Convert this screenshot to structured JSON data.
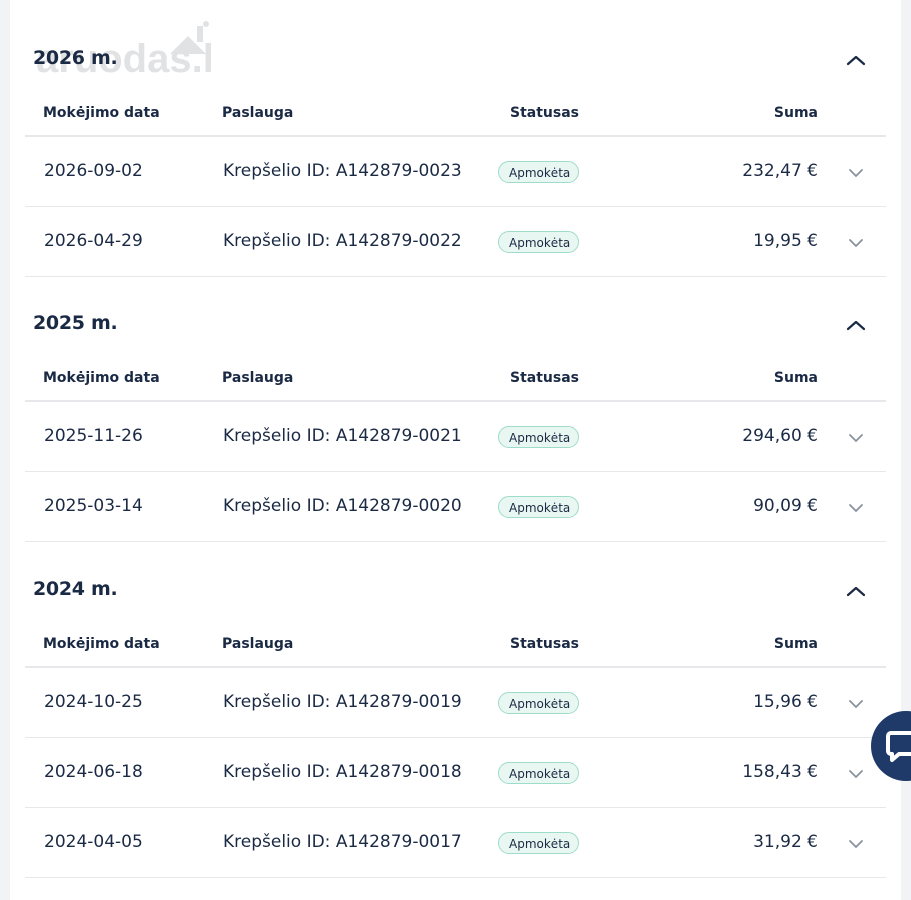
{
  "brand": {
    "logo_text": "aruodas.lt"
  },
  "colors": {
    "text": "#1b2a44",
    "badge_bg": "#e9f7f2",
    "badge_border": "#9edbc9",
    "chat_bg": "#1f3a68"
  },
  "columns": {
    "date": "Mokėjimo data",
    "service": "Paslauga",
    "status": "Statusas",
    "sum": "Suma"
  },
  "sections": [
    {
      "year": "2026 m.",
      "rows": [
        {
          "date": "2026-09-02",
          "service": "Krepšelio ID: A142879-0023",
          "status": "Apmokėta",
          "sum": "232,47 €"
        },
        {
          "date": "2026-04-29",
          "service": "Krepšelio ID: A142879-0022",
          "status": "Apmokėta",
          "sum": "19,95 €"
        }
      ]
    },
    {
      "year": "2025 m.",
      "rows": [
        {
          "date": "2025-11-26",
          "service": "Krepšelio ID: A142879-0021",
          "status": "Apmokėta",
          "sum": "294,60 €"
        },
        {
          "date": "2025-03-14",
          "service": "Krepšelio ID: A142879-0020",
          "status": "Apmokėta",
          "sum": "90,09 €"
        }
      ]
    },
    {
      "year": "2024 m.",
      "rows": [
        {
          "date": "2024-10-25",
          "service": "Krepšelio ID: A142879-0019",
          "status": "Apmokėta",
          "sum": "15,96 €"
        },
        {
          "date": "2024-06-18",
          "service": "Krepšelio ID: A142879-0018",
          "status": "Apmokėta",
          "sum": "158,43 €"
        },
        {
          "date": "2024-04-05",
          "service": "Krepšelio ID: A142879-0017",
          "status": "Apmokėta",
          "sum": "31,92 €"
        }
      ]
    }
  ],
  "icons": {
    "collapse": "chevron-up-icon",
    "expand": "chevron-down-icon",
    "chat": "chat-bubble-icon",
    "logo_roof": "house-roof-icon"
  }
}
